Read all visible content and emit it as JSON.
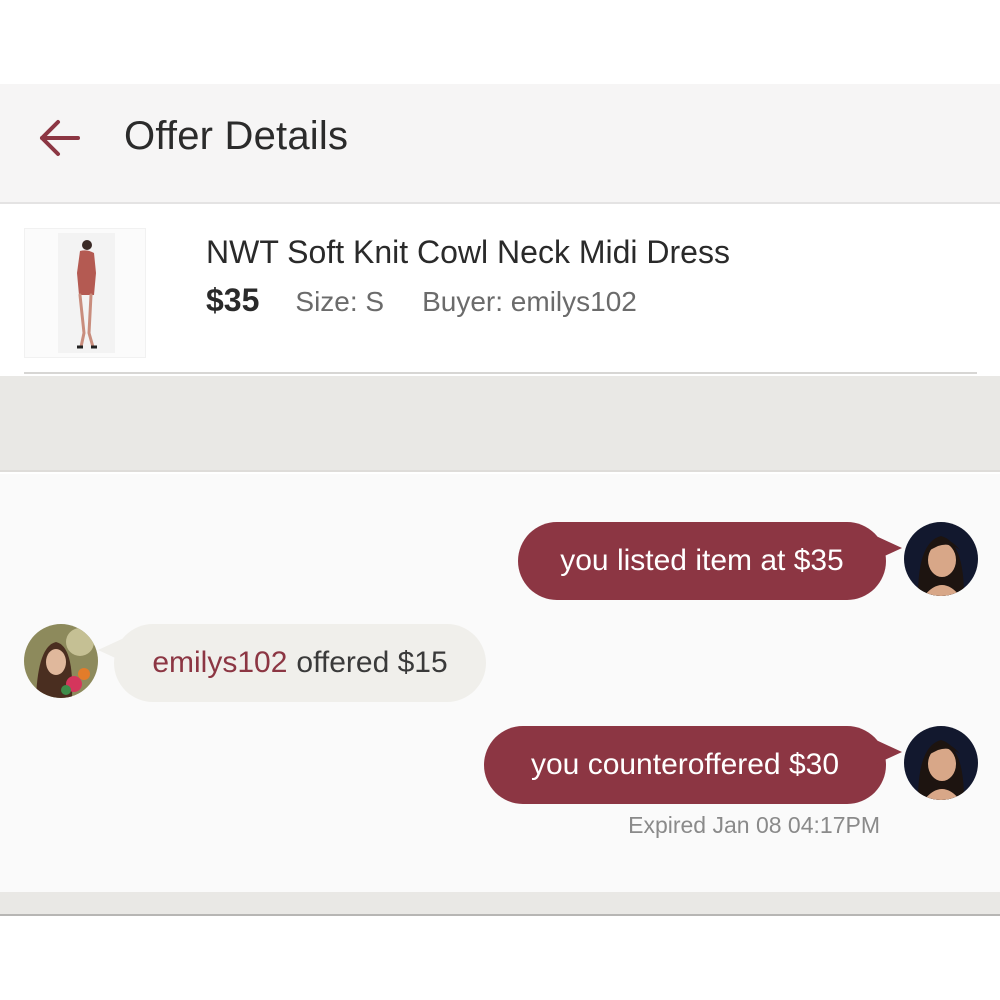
{
  "header": {
    "title": "Offer Details",
    "back_icon": "arrow-left-icon",
    "accent_color": "#8c3643"
  },
  "item": {
    "title": "NWT Soft Knit Cowl Neck Midi Dress",
    "price": "$35",
    "size": "Size: S",
    "buyer": "Buyer: emilys102"
  },
  "conversation": {
    "listed": "you listed item at $35",
    "offer_user": "emilys102",
    "offer_text": "offered $15",
    "counter": "you counteroffered $30",
    "expiry": "Expired Jan 08 04:17PM"
  },
  "colors": {
    "outgoing_bubble": "#8c3643",
    "incoming_bubble": "#f0efeb"
  }
}
